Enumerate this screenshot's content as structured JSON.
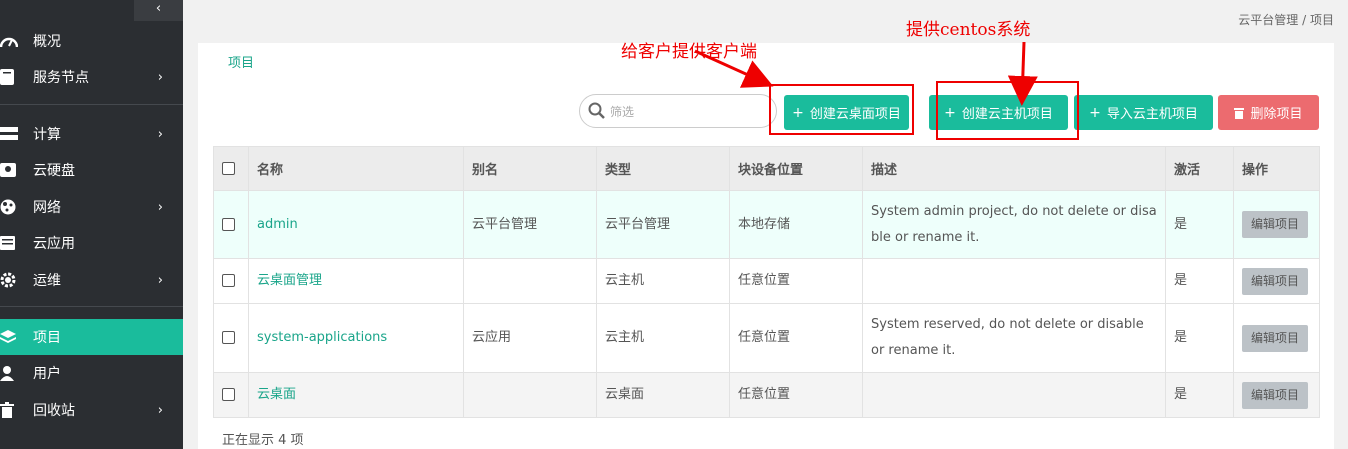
{
  "sidebar": {
    "collapse_glyph": "‹",
    "items": [
      {
        "label": "概况",
        "icon": "dashboard-icon",
        "chevron": ""
      },
      {
        "label": "服务节点",
        "icon": "server-icon",
        "chevron": "›"
      },
      {
        "label": "计算",
        "icon": "compute-icon",
        "chevron": "›"
      },
      {
        "label": "云硬盘",
        "icon": "disk-icon",
        "chevron": ""
      },
      {
        "label": "网络",
        "icon": "network-icon",
        "chevron": "›"
      },
      {
        "label": "云应用",
        "icon": "app-icon",
        "chevron": ""
      },
      {
        "label": "运维",
        "icon": "gear-icon",
        "chevron": "›"
      },
      {
        "label": "项目",
        "icon": "layers-icon",
        "chevron": "",
        "active": true
      },
      {
        "label": "用户",
        "icon": "user-icon",
        "chevron": ""
      },
      {
        "label": "回收站",
        "icon": "trash-icon",
        "chevron": "›"
      }
    ]
  },
  "breadcrumb": {
    "parent": "云平台管理",
    "sep": " / ",
    "current": "项目"
  },
  "panel": {
    "title": "项目"
  },
  "search": {
    "placeholder": "筛选"
  },
  "toolbar": {
    "create_desktop": "创建云桌面项目",
    "create_host": "创建云主机项目",
    "import_host": "导入云主机项目",
    "delete": "删除项目",
    "plus": "+"
  },
  "table": {
    "headers": [
      "名称",
      "别名",
      "类型",
      "块设备位置",
      "描述",
      "激活",
      "操作"
    ],
    "rows": [
      {
        "name": "admin",
        "alias": "云平台管理",
        "type": "云平台管理",
        "location": "本地存储",
        "desc": "System admin project, do not delete or disable or rename it.",
        "active": "是",
        "action": "编辑项目"
      },
      {
        "name": "云桌面管理",
        "alias": "",
        "type": "云主机",
        "location": "任意位置",
        "desc": "",
        "active": "是",
        "action": "编辑项目"
      },
      {
        "name": "system-applications",
        "alias": "云应用",
        "type": "云主机",
        "location": "任意位置",
        "desc": "System reserved, do not delete or disable or rename it.",
        "active": "是",
        "action": "编辑项目"
      },
      {
        "name": "云桌面",
        "alias": "",
        "type": "云桌面",
        "location": "任意位置",
        "desc": "",
        "active": "是",
        "action": "编辑项目"
      }
    ]
  },
  "footer": {
    "count_text": "正在显示 4 项"
  },
  "annotations": {
    "note1": "给客户提供客户端",
    "note2": "提供centos系统",
    "color": "#ee0000"
  },
  "colors": {
    "accent": "#1abc9c",
    "danger": "#ec6b6f",
    "sidebar": "#2b2e32"
  }
}
